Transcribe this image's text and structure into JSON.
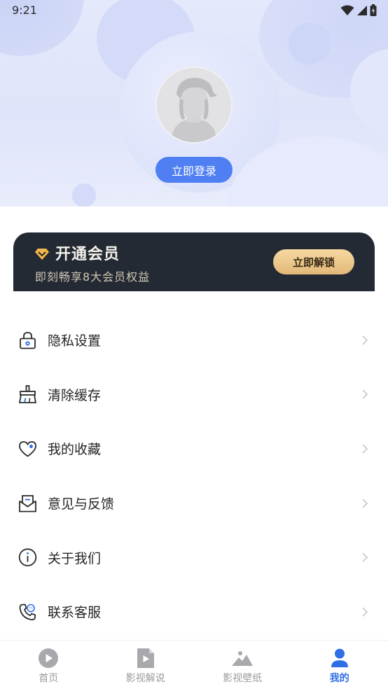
{
  "status_bar": {
    "time": "9:21"
  },
  "profile": {
    "login_label": "立即登录"
  },
  "vip": {
    "title": "开通会员",
    "subtitle": "即刻畅享8大会员权益",
    "unlock_label": "立即解锁"
  },
  "menu": {
    "items": [
      {
        "label": "隐私设置",
        "icon": "lock-icon"
      },
      {
        "label": "清除缓存",
        "icon": "broom-icon"
      },
      {
        "label": "我的收藏",
        "icon": "heart-icon"
      },
      {
        "label": "意见与反馈",
        "icon": "mail-icon"
      },
      {
        "label": "关于我们",
        "icon": "info-icon"
      },
      {
        "label": "联系客服",
        "icon": "phone-icon"
      }
    ]
  },
  "bottom_nav": {
    "items": [
      {
        "label": "首页",
        "icon": "play-icon",
        "active": false
      },
      {
        "label": "影视解说",
        "icon": "video-file-icon",
        "active": false
      },
      {
        "label": "影视壁纸",
        "icon": "image-icon",
        "active": false
      },
      {
        "label": "我的",
        "icon": "person-icon",
        "active": true
      }
    ]
  },
  "colors": {
    "accent": "#4f7ff2",
    "active_tab": "#2f6ee6",
    "vip_card": "#242a33",
    "vip_button": "#e8c07f"
  }
}
